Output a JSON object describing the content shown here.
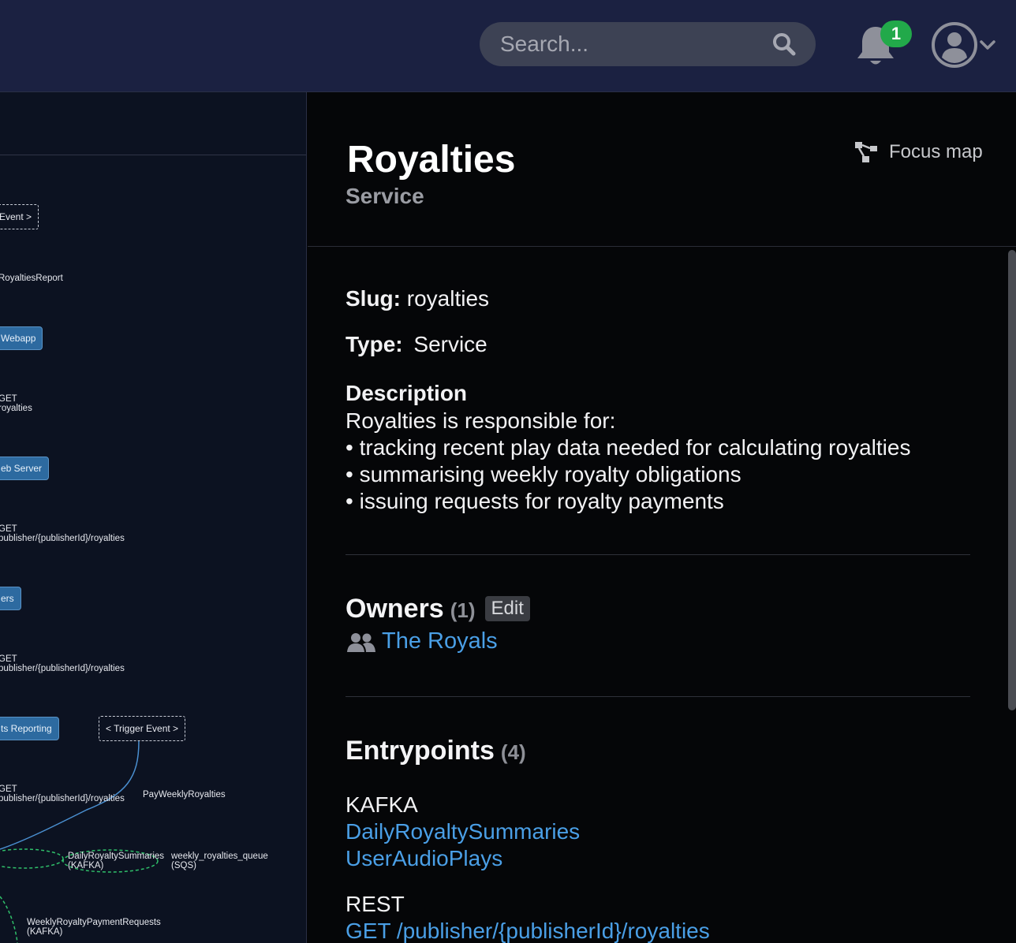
{
  "header": {
    "search_placeholder": "Search...",
    "notification_count": "1"
  },
  "diagram": {
    "nodes": {
      "trigger_top": "Event >",
      "report_label": "RoyaltiesReport",
      "webapp": "Webapp",
      "get1": "GET\nroyalties",
      "web_server": "eb Server",
      "get2": "GET\npublisher/{publisherId}/royalties",
      "ers": "ers",
      "get3": "GET\npublisher/{publisherId}/royalties",
      "reporting": "ts Reporting",
      "trigger_event": "< Trigger Event >",
      "get4": "GET\npublisher/{publisherId}/royalties",
      "pay_weekly": "PayWeeklyRoyalties",
      "daily_summaries": "DailyRoyaltySummaries\n(KAFKA)",
      "weekly_queue": "weekly_royalties_queue\n(SQS)",
      "weekly_payment": "WeeklyRoyaltyPaymentRequests\n(KAFKA)"
    }
  },
  "details": {
    "title": "Royalties",
    "subtitle": "Service",
    "focus_label": "Focus map",
    "slug_label": "Slug:",
    "slug_value": "royalties",
    "type_label": "Type:",
    "type_value": "Service",
    "description_title": "Description",
    "description_intro": "Royalties is responsible for:",
    "description_points": [
      "tracking recent play data needed for calculating royalties",
      "summarising weekly royalty obligations",
      "issuing requests for royalty payments"
    ],
    "owners_title": "Owners",
    "owners_count": "(1)",
    "edit_label": "Edit",
    "owner_name": "The Royals",
    "entrypoints_title": "Entrypoints",
    "entrypoints_count": "(4)",
    "entrypoints": {
      "kafka_label": "KAFKA",
      "kafka_items": [
        "DailyRoyaltySummaries",
        "UserAudioPlays"
      ],
      "rest_label": "REST",
      "rest_items": [
        "GET /publisher/{publisherId}/royalties"
      ]
    }
  },
  "colors": {
    "header_bg": "#1b2141",
    "link": "#4a9fe6",
    "badge": "#22a94a",
    "node": "#2d6aa0"
  }
}
